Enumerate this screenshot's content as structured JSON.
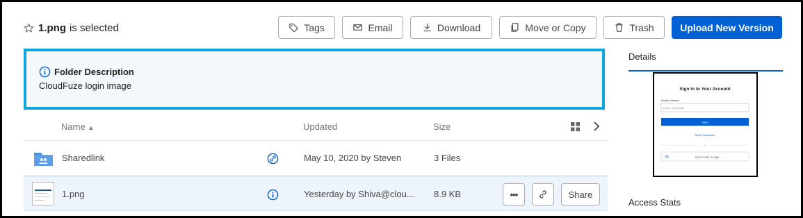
{
  "header": {
    "selection_name": "1.png",
    "selection_suffix": "is selected",
    "buttons": {
      "tags": "Tags",
      "email": "Email",
      "download": "Download",
      "move_copy": "Move or Copy",
      "trash": "Trash",
      "upload": "Upload New Version"
    }
  },
  "folder_description": {
    "title": "Folder Description",
    "text": "CloudFuze login image"
  },
  "table": {
    "columns": {
      "name": "Name",
      "updated": "Updated",
      "size": "Size"
    },
    "rows": [
      {
        "name": "Sharedlink",
        "updated": "May 10, 2020 by Steven",
        "size": "3 Files",
        "icon": "folder-icon"
      },
      {
        "name": "1.png",
        "updated": "Yesterday by Shiva@clou...",
        "size": "8.9 KB",
        "icon": "image-thumbnail"
      }
    ],
    "row_actions": {
      "more": "•••",
      "share": "Share"
    }
  },
  "sidebar": {
    "tab": "Details",
    "access_stats": "Access Stats",
    "preview": {
      "title": "Sign In to Your Account",
      "email_label": "Email Address",
      "email_placeholder": "Enter Your Email",
      "next": "Next",
      "reset": "Reset Password",
      "or": "or",
      "google": "Sign in with Google"
    }
  },
  "colors": {
    "accent": "#0061d5",
    "highlight_border": "#0ea5dd",
    "selected_row": "#edf4fb"
  }
}
